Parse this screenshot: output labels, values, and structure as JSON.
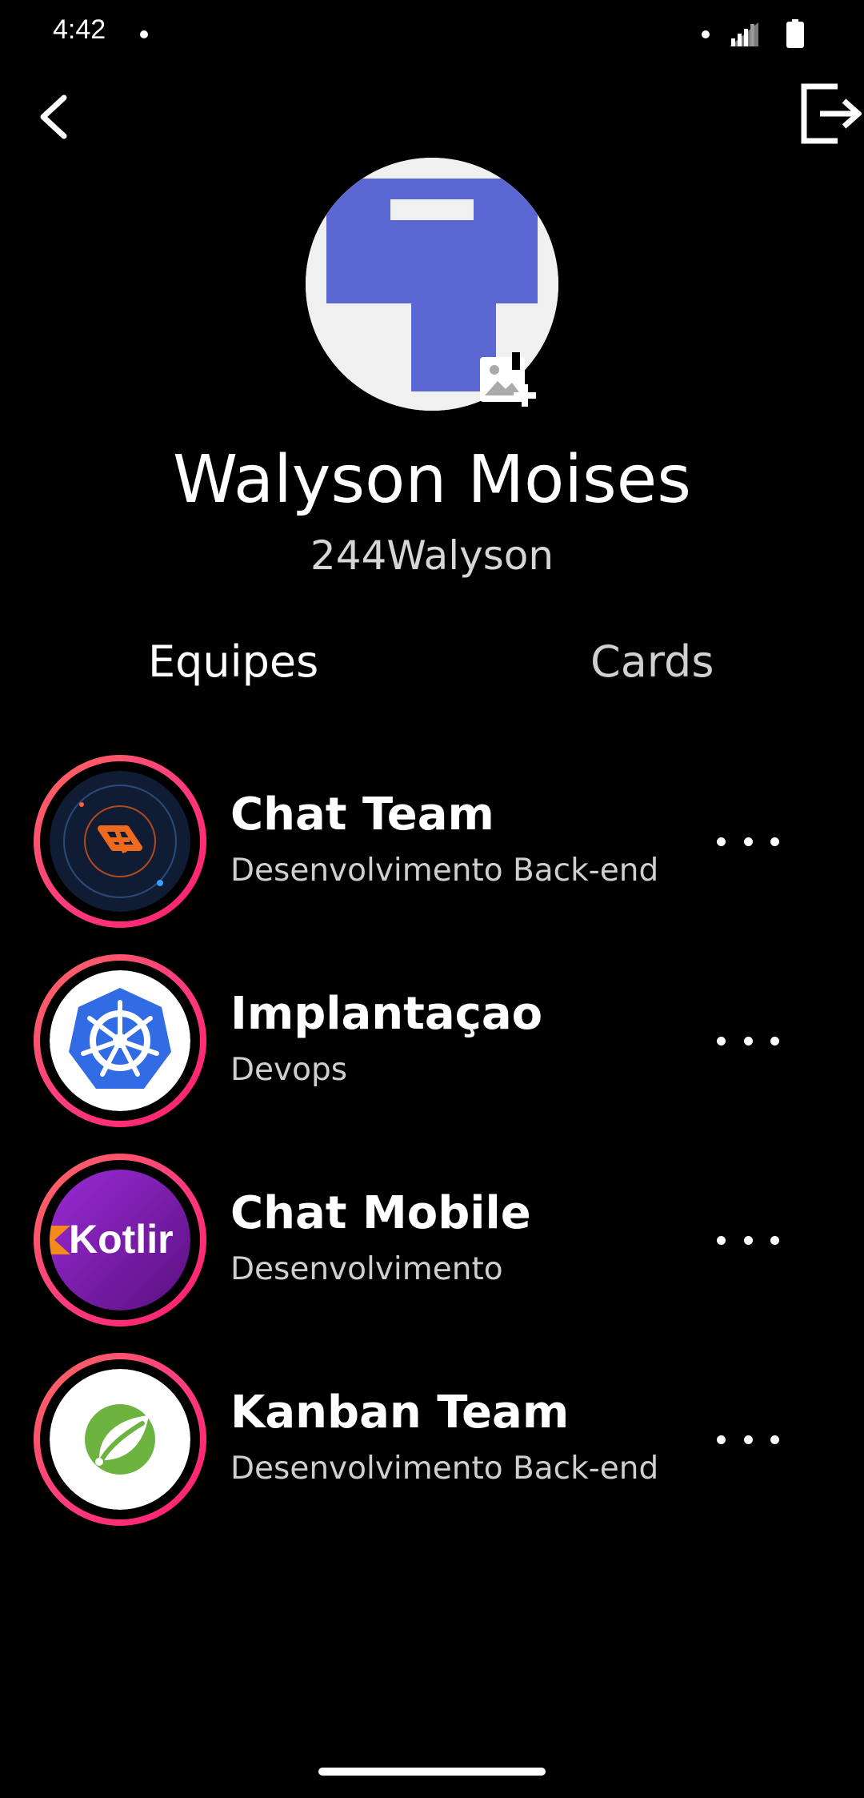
{
  "status_bar": {
    "time": "4:42"
  },
  "header": {
    "back_icon": "chevron-left-icon",
    "logout_icon": "logout-icon"
  },
  "profile": {
    "name": "Walyson Moises",
    "username": "244Walyson",
    "avatar_color": "#5b67d2",
    "add_photo_icon": "add-photo-icon"
  },
  "tabs": [
    {
      "label": "Equipes",
      "active": true
    },
    {
      "label": "Cards",
      "active": false
    }
  ],
  "teams": [
    {
      "name": "Chat Team",
      "description": "Desenvolvimento Back-end",
      "logo": "kafka-logo"
    },
    {
      "name": "Implantaçao",
      "description": "Devops",
      "logo": "kubernetes-logo"
    },
    {
      "name": "Chat Mobile",
      "description": "Desenvolvimento",
      "logo": "kotlin-logo",
      "logo_text": "Kotlir"
    },
    {
      "name": "Kanban Team",
      "description": "Desenvolvimento Back-end",
      "logo": "spring-logo"
    }
  ],
  "colors": {
    "background": "#000000",
    "ring_gradient_start": "#ff6a5c",
    "ring_gradient_end": "#ff1c6e",
    "kubernetes_blue": "#326ce5",
    "spring_green": "#6db33f"
  }
}
